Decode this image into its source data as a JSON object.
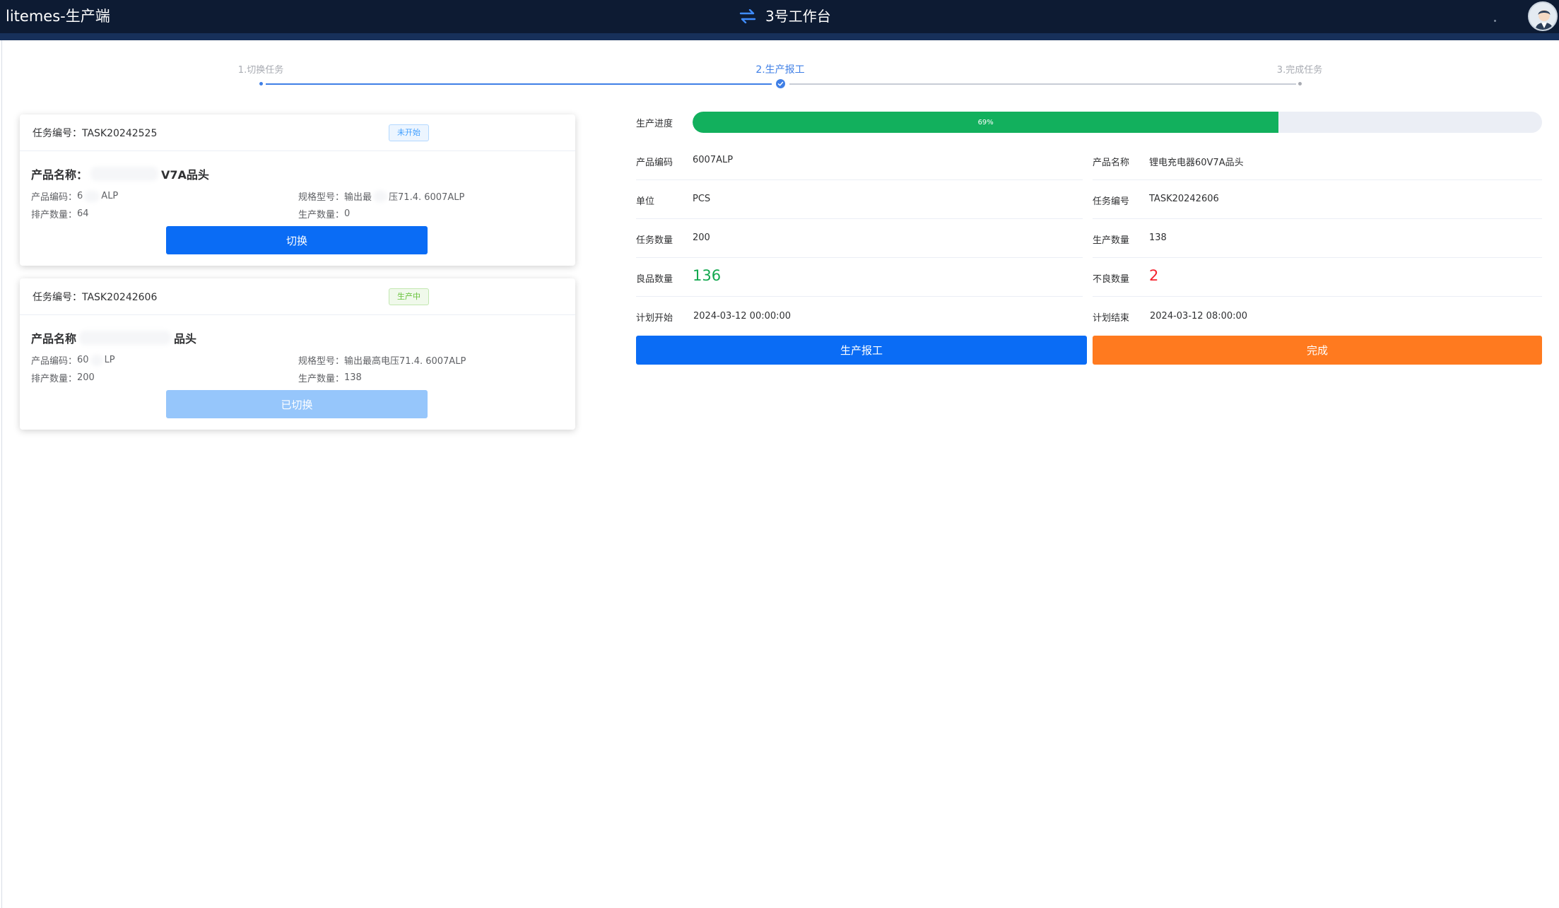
{
  "header": {
    "app_title": "litemes-生产端",
    "workstation": "3号工作台",
    "icon": "swap-arrows-icon",
    "avatar_icon": "user-avatar-icon"
  },
  "steps": [
    {
      "label": "1.切换任务",
      "state": "done"
    },
    {
      "label": "2.生产报工",
      "state": "active"
    },
    {
      "label": "3.完成任务",
      "state": "pending"
    }
  ],
  "tasks": [
    {
      "task_label": "任务编号：TASK20242525",
      "status": "未开始",
      "product_name_label": "产品名称：",
      "product_name_visible": "V7A品头",
      "code_label": "产品编码：",
      "code_prefix": "6",
      "code_suffix": "ALP",
      "spec_label": "规格型号：",
      "spec_prefix": "输出最",
      "spec_suffix": "压71.4. 6007ALP",
      "plan_qty_label": "排产数量：",
      "plan_qty": "64",
      "prod_qty_label": "生产数量：",
      "prod_qty": "0",
      "button": "切换"
    },
    {
      "task_label": "任务编号：TASK20242606",
      "status": "生产中",
      "product_name_label": "产品名称",
      "product_name_visible": "品头",
      "code_label": "产品编码：",
      "code_prefix": "60",
      "code_suffix": "LP",
      "spec_label": "规格型号：",
      "spec_prefix": "输出最高电压71.4. 6007ALP",
      "spec_suffix": "",
      "plan_qty_label": "排产数量：",
      "plan_qty": "200",
      "prod_qty_label": "生产数量：",
      "prod_qty": "138",
      "button": "已切换"
    }
  ],
  "detail": {
    "progress_label": "生产进度",
    "progress_percent": 69,
    "progress_text": "69%",
    "product_code_label": "产品编码",
    "product_code": "6007ALP",
    "product_name_label": "产品名称",
    "product_name": "锂电充电器60V7A品头",
    "unit_label": "单位",
    "unit": "PCS",
    "task_no_label": "任务编号",
    "task_no": "TASK20242606",
    "task_qty_label": "任务数量",
    "task_qty": "200",
    "prod_qty_label": "生产数量",
    "prod_qty": "138",
    "good_qty_label": "良品数量",
    "good_qty": "136",
    "bad_qty_label": "不良数量",
    "bad_qty": "2",
    "plan_start_label": "计划开始",
    "plan_start": "2024-03-12 00:00:00",
    "plan_end_label": "计划结束",
    "plan_end": "2024-03-12 08:00:00",
    "report_button": "生产报工",
    "finish_button": "完成",
    "colors": {
      "primary": "#0a6cf5",
      "orange": "#ff7a1f",
      "green": "#12b05d",
      "red": "#f5222d"
    }
  }
}
